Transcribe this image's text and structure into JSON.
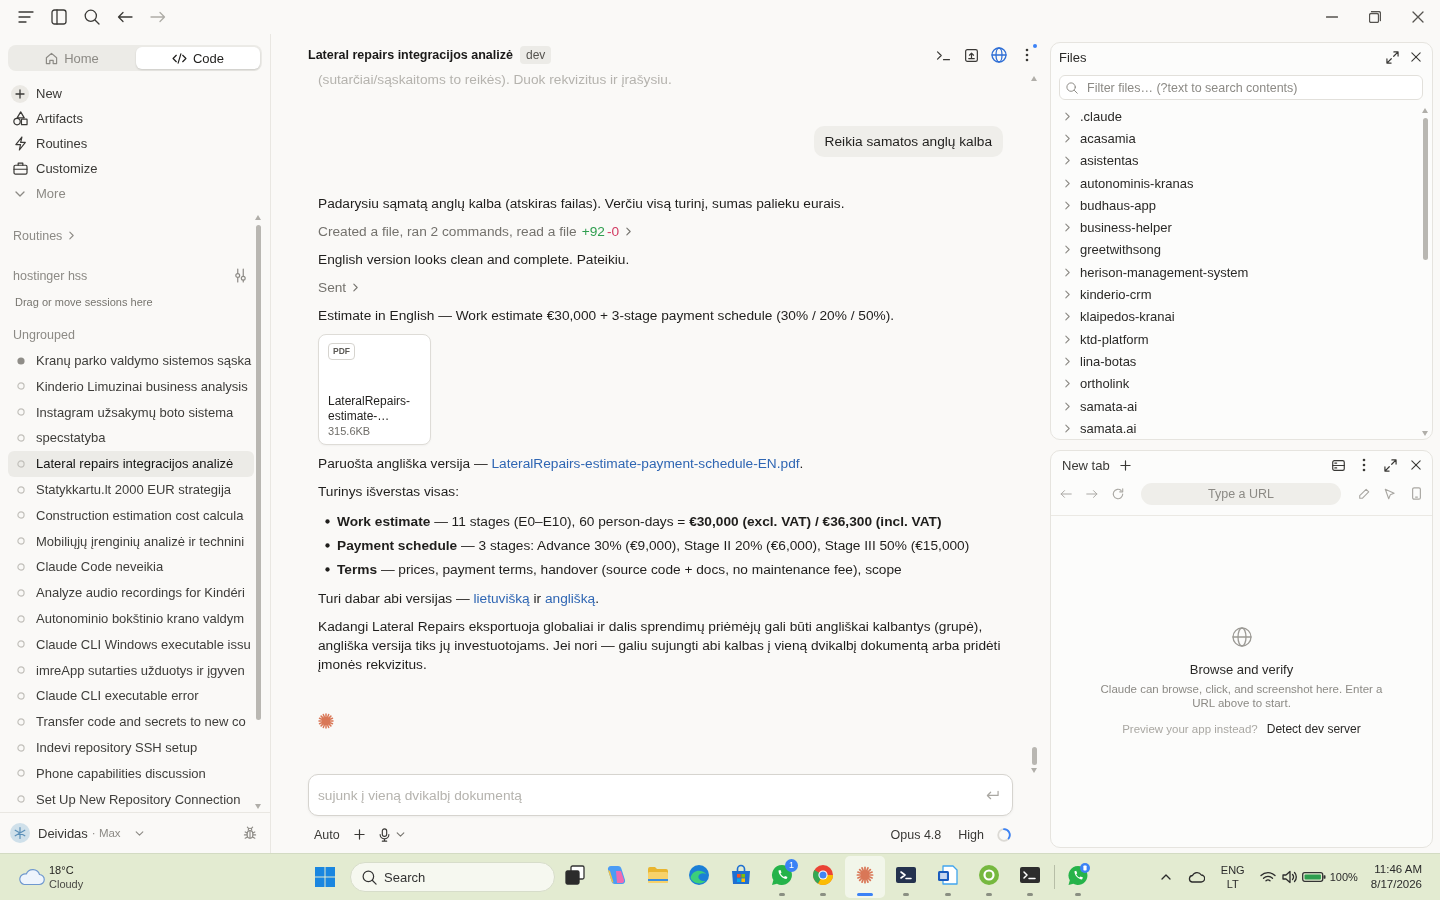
{
  "sidebar": {
    "mode_tabs": [
      {
        "label": "Home",
        "selected": false
      },
      {
        "label": "Code",
        "selected": true
      }
    ],
    "nav": [
      {
        "kind": "link",
        "label": "New"
      },
      {
        "kind": "link",
        "label": "Artifacts"
      },
      {
        "kind": "link",
        "label": "Routines"
      },
      {
        "kind": "link",
        "label": "Customize"
      },
      {
        "kind": "toggle",
        "label": "More",
        "expanded": false
      }
    ],
    "routines_link": "Routines",
    "group": {
      "name": "hostinger hss",
      "hint": "Drag or move sessions here"
    },
    "ungrouped_label": "Ungrouped",
    "sessions": [
      {
        "title": "Kranų parko valdymo sistemos sąska",
        "running": true,
        "selected": false
      },
      {
        "title": "Kinderio Limuzinai business analysis",
        "running": false,
        "selected": false
      },
      {
        "title": "Instagram užsakymų boto sistema",
        "running": false,
        "selected": false
      },
      {
        "title": "specstatyba",
        "running": false,
        "selected": false
      },
      {
        "title": "Lateral repairs integracijos analizė",
        "running": false,
        "selected": true
      },
      {
        "title": "Statykkartu.lt 2000 EUR strategija",
        "running": false,
        "selected": false
      },
      {
        "title": "Construction estimation cost calcula",
        "running": false,
        "selected": false
      },
      {
        "title": "Mobiliųjų įrenginių analizė ir technini",
        "running": false,
        "selected": false
      },
      {
        "title": "Claude Code neveikia",
        "running": false,
        "selected": false
      },
      {
        "title": "Analyze audio recordings for Kindéri",
        "running": false,
        "selected": false
      },
      {
        "title": "Autonominio bokštinio krano valdym",
        "running": false,
        "selected": false
      },
      {
        "title": "Claude CLI Windows executable issu",
        "running": false,
        "selected": false
      },
      {
        "title": "imreApp sutarties užduotys ir įgyven",
        "running": false,
        "selected": false
      },
      {
        "title": "Claude CLI executable error",
        "running": false,
        "selected": false
      },
      {
        "title": "Transfer code and secrets to new co",
        "running": false,
        "selected": false
      },
      {
        "title": "Indevi repository SSH setup",
        "running": false,
        "selected": false
      },
      {
        "title": "Phone capabilities discussion",
        "running": false,
        "selected": false
      },
      {
        "title": "Set Up New Repository Connection",
        "running": false,
        "selected": false
      }
    ],
    "account": {
      "name": "Deividas",
      "plan": "· Max"
    }
  },
  "chat": {
    "title": "Lateral repairs integracijos analizė",
    "branch": "dev",
    "messages": [
      {
        "kind": "faded",
        "text": "(sutarčiai/sąskaitoms to reikės). Duok rekvizitus ir įrašysiu."
      },
      {
        "kind": "user",
        "text": "Reikia samatos anglų kalba"
      },
      {
        "kind": "text",
        "parts": [
          {
            "kind": "plain",
            "text": "Padarysiu sąmatą anglų kalba (atskiras failas). Verčiu visą turinį, sumas palieku eurais."
          }
        ]
      },
      {
        "kind": "activity",
        "text": "Created a file, ran 2 commands, read a file",
        "added": "+92",
        "removed": "-0"
      },
      {
        "kind": "text",
        "parts": [
          {
            "kind": "plain",
            "text": "English version looks clean and complete. Pateikiu."
          }
        ]
      },
      {
        "kind": "activity",
        "text": "Sent"
      },
      {
        "kind": "text",
        "parts": [
          {
            "kind": "plain",
            "text": "Estimate in English — Work estimate €30,000 + 3-stage payment schedule (30% / 20% / 50%)."
          }
        ]
      },
      {
        "kind": "file",
        "type": "PDF",
        "name": "LateralRepairs-estimate-…",
        "size": "315.6KB"
      },
      {
        "kind": "text",
        "parts": [
          {
            "kind": "plain",
            "text": "Paruošta angliška versija — "
          },
          {
            "kind": "link",
            "text": "LateralRepairs-estimate-payment-schedule-EN.pdf"
          },
          {
            "kind": "plain",
            "text": "."
          }
        ]
      },
      {
        "kind": "text",
        "parts": [
          {
            "kind": "plain",
            "text": "Turinys išverstas visas:"
          }
        ]
      },
      {
        "kind": "list",
        "items": [
          "**Work estimate** — 11 stages (E0–E10), 60 person-days = **€30,000 (excl. VAT) / €36,300 (incl. VAT)**",
          "**Payment schedule** — 3 stages: Advance 30% (€9,000), Stage II 20% (€6,000), Stage III 50% (€15,000)",
          "**Terms** — prices, payment terms, handover (source code + docs, no maintenance fee), scope"
        ]
      },
      {
        "kind": "text",
        "parts": [
          {
            "kind": "plain",
            "text": "Turi dabar abi versijas — "
          },
          {
            "kind": "link",
            "text": "lietuvišką"
          },
          {
            "kind": "plain",
            "text": " ir "
          },
          {
            "kind": "link",
            "text": "anglišką"
          },
          {
            "kind": "plain",
            "text": "."
          }
        ]
      },
      {
        "kind": "text",
        "parts": [
          {
            "kind": "plain",
            "text": "Kadangi Lateral Repairs eksportuoja globaliai ir dalis sprendimų priėmėjų gali būti angliškai kalbantys (grupė), angliška versija tiks jų investuotojams. Jei nori — galiu sujungti abi kalbas į vieną dvikalbį dokumentą arba pridėti įmonės rekvizitus."
          }
        ]
      },
      {
        "kind": "working"
      }
    ]
  },
  "composer": {
    "placeholder": "sujunk į vieną dvikalbį dokumentą",
    "mode": "Auto",
    "model": "Opus 4.8",
    "effort": "High"
  },
  "files": {
    "title": "Files",
    "filter_placeholder": "Filter files… (?text to search contents)",
    "folders": [
      {
        "name": ".claude",
        "expanded": false
      },
      {
        "name": "acasamia",
        "expanded": false
      },
      {
        "name": "asistentas",
        "expanded": false
      },
      {
        "name": "autonominis-kranas",
        "expanded": false
      },
      {
        "name": "budhaus-app",
        "expanded": false
      },
      {
        "name": "business-helper",
        "expanded": false
      },
      {
        "name": "greetwithsong",
        "expanded": false
      },
      {
        "name": "herison-management-system",
        "expanded": false
      },
      {
        "name": "kinderio-crm",
        "expanded": false
      },
      {
        "name": "klaipedos-kranai",
        "expanded": false
      },
      {
        "name": "ktd-platform",
        "expanded": false
      },
      {
        "name": "lina-botas",
        "expanded": false
      },
      {
        "name": "ortholink",
        "expanded": false
      },
      {
        "name": "samata-ai",
        "expanded": false
      },
      {
        "name": "samata.ai",
        "expanded": false
      }
    ]
  },
  "browser": {
    "tab": "New tab",
    "url_placeholder": "Type a URL",
    "empty_title": "Browse and verify",
    "empty_text": "Claude can browse, click, and screenshot here. Enter a URL above to start.",
    "preview_prompt": "Preview your app instead?",
    "detect_label": "Detect dev server"
  },
  "taskbar": {
    "weather": {
      "temperature": "18°C",
      "condition": "Cloudy"
    },
    "search": {
      "placeholder": "Search"
    },
    "apps": [
      {
        "running": false,
        "selected": false
      },
      {
        "running": false,
        "selected": false
      },
      {
        "running": false,
        "selected": false
      },
      {
        "running": false,
        "selected": false
      },
      {
        "running": false,
        "selected": false
      },
      {
        "running": true,
        "selected": false,
        "badge": "1"
      },
      {
        "running": true,
        "selected": false
      },
      {
        "running": true,
        "selected": true
      },
      {
        "running": true,
        "selected": false
      },
      {
        "running": true,
        "selected": false
      },
      {
        "running": true,
        "selected": false
      },
      {
        "running": true,
        "selected": false
      },
      {
        "running": true,
        "selected": false
      }
    ],
    "tray": {
      "language": "ENG",
      "layout": "LT",
      "battery": "100%",
      "time": "11:46 AM",
      "date": "8/17/2026"
    }
  }
}
